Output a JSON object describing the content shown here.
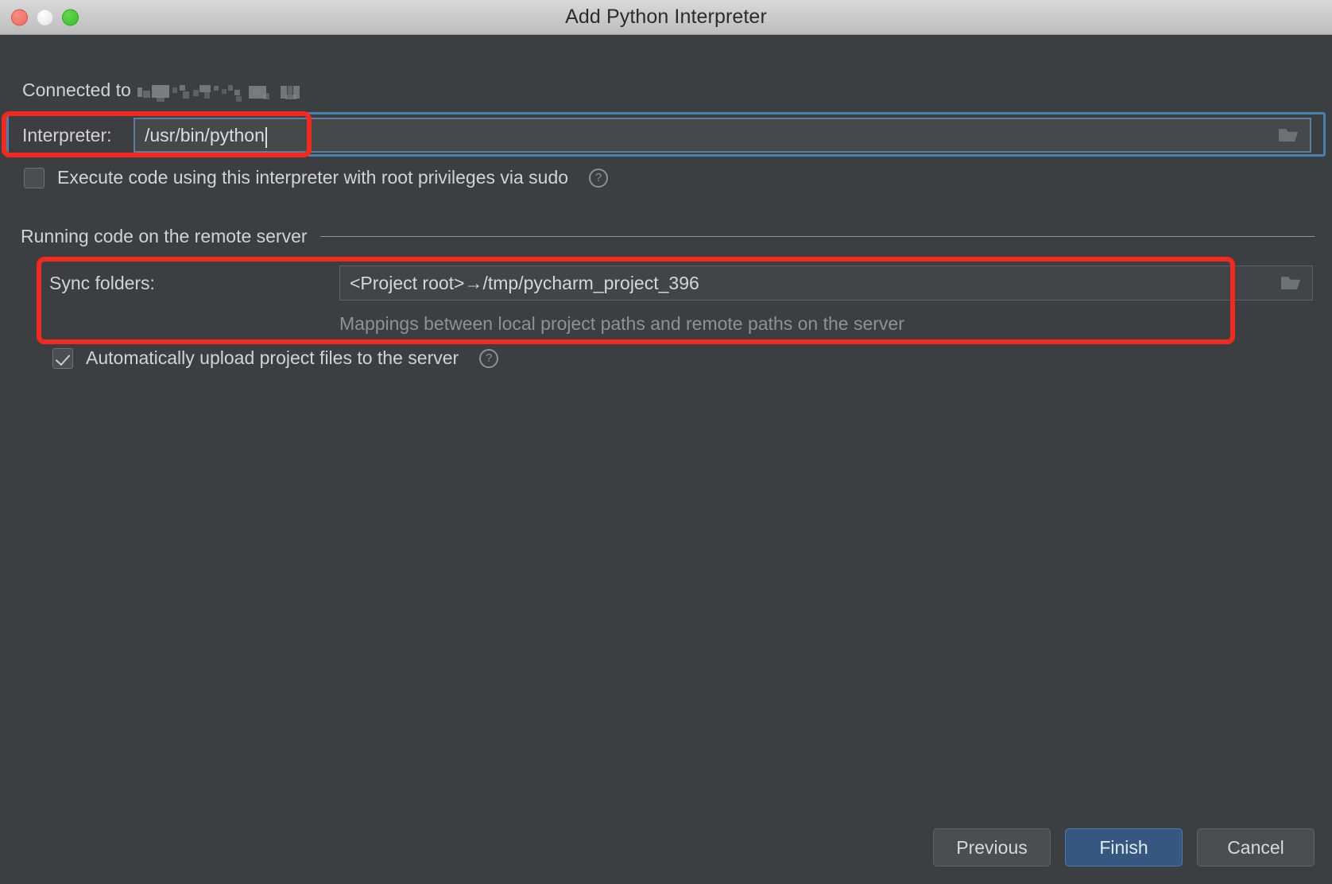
{
  "window": {
    "title": "Add Python Interpreter",
    "traffic_lights": [
      "close-button",
      "minimize-button",
      "zoom-button"
    ]
  },
  "connection": {
    "label": "Connected to ",
    "host_redacted": true
  },
  "interpreter": {
    "label": "Interpreter:",
    "value": "/usr/bin/python",
    "placeholder": "",
    "browse_icon": "folder-icon",
    "focused": true
  },
  "sudo": {
    "label": "Execute code using this interpreter with root privileges via sudo",
    "checked": false,
    "help_icon": "?"
  },
  "section": {
    "title": "Running code on the remote server"
  },
  "sync": {
    "label": "Sync folders:",
    "value": "<Project root>→/tmp/pycharm_project_396",
    "browse_icon": "folder-icon",
    "hint": "Mappings between local project paths and remote paths on the server"
  },
  "auto_upload": {
    "label": "Automatically upload project files to the server",
    "checked": true,
    "help_icon": "?"
  },
  "footer": {
    "previous_label": "Previous",
    "finish_label": "Finish",
    "cancel_label": "Cancel"
  },
  "annotations": {
    "color": "#f4291d",
    "boxes": [
      "interpreter-field-highlight",
      "sync-folders-highlight"
    ]
  },
  "colors": {
    "dialog_bg": "#3c3f41",
    "titlebar_bg": "#cbcbcb",
    "accent_blue": "#365880",
    "focus_blue": "#4b7fb0",
    "annotation_red": "#f4291d",
    "text": "#d3d3d3",
    "muted_text": "#8e9294"
  }
}
